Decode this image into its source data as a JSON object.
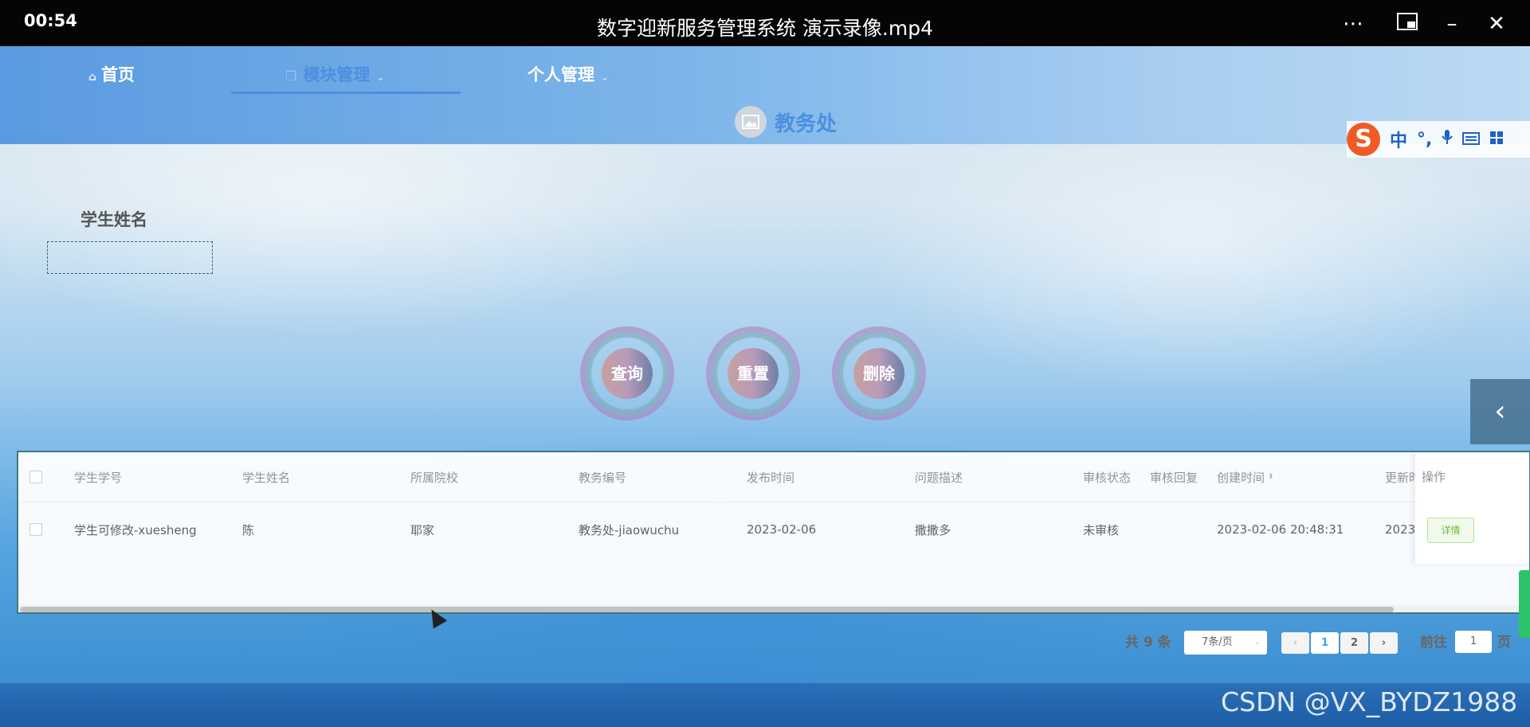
{
  "player": {
    "time": "00:54",
    "title": "数字迎新服务管理系统 演示录像.mp4"
  },
  "nav": {
    "items": [
      {
        "label": "首页"
      },
      {
        "label": "模块管理"
      },
      {
        "label": "个人管理"
      }
    ],
    "brand": "教务处"
  },
  "ime": {
    "glyphs": [
      "中",
      "°,"
    ]
  },
  "search": {
    "label": "学生姓名",
    "value": ""
  },
  "buttons": {
    "query": "查询",
    "reset": "重置",
    "delete": "删除"
  },
  "table": {
    "columns": [
      "学生学号",
      "学生姓名",
      "所属院校",
      "教务编号",
      "发布时间",
      "问题描述",
      "审核状态",
      "审核回复",
      "创建时间",
      "更新时",
      "操作"
    ],
    "rows": [
      {
        "student_no": "学生可修改-xuesheng",
        "student_name": "陈",
        "school": "耶家",
        "affairs_no": "教务处-jiaowuchu",
        "publish_time": "2023-02-06",
        "description": "撒撒多",
        "audit_status": "未审核",
        "audit_reply": "",
        "created": "2023-02-06 20:48:31",
        "updated": "2023-",
        "action": "详情"
      }
    ]
  },
  "pagination": {
    "total": "共 9 条",
    "page_size": "7条/页",
    "pages": [
      "1",
      "2"
    ],
    "current": "1",
    "goto_label": "前往",
    "goto_value": "1",
    "page_unit": "页"
  },
  "watermark": "CSDN @VX_BYDZ1988"
}
